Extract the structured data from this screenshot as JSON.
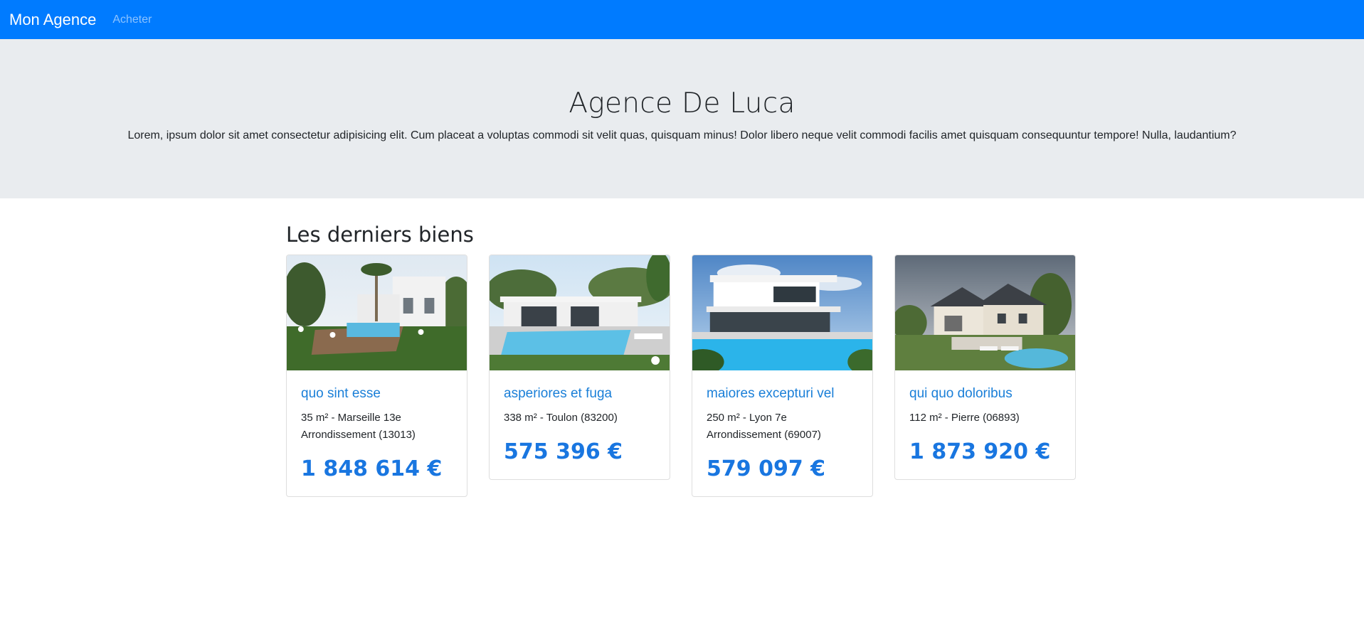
{
  "navbar": {
    "brand": "Mon Agence",
    "links": [
      {
        "label": "Acheter"
      }
    ]
  },
  "hero": {
    "title": "Agence De Luca",
    "lead": "Lorem, ipsum dolor sit amet consectetur adipisicing elit. Cum placeat a voluptas commodi sit velit quas, quisquam minus! Dolor libero neque velit commodi facilis amet quisquam consequuntur tempore! Nulla, laudantium?"
  },
  "latest": {
    "heading": "Les derniers biens",
    "properties": [
      {
        "title": "quo sint esse",
        "details": "35 m² - Marseille 13e Arrondissement (13013)",
        "price": "1 848 614 €"
      },
      {
        "title": "asperiores et fuga",
        "details": "338 m² - Toulon (83200)",
        "price": "575 396 €"
      },
      {
        "title": "maiores excepturi vel",
        "details": "250 m² - Lyon 7e Arrondissement (69007)",
        "price": "579 097 €"
      },
      {
        "title": "qui quo doloribus",
        "details": "112 m² - Pierre (06893)",
        "price": "1 873 920 €"
      }
    ]
  },
  "colors": {
    "navbar_bg": "#007bff",
    "hero_bg": "#e9ecef",
    "title_link": "#1a7fd8",
    "price": "#1976e0"
  }
}
